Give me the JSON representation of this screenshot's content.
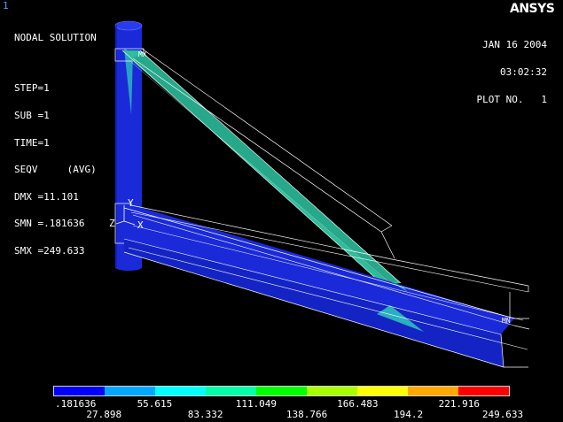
{
  "window_number": "1",
  "logo": "ANSYS",
  "info": {
    "title": "NODAL SOLUTION",
    "step": "STEP=1",
    "sub": "SUB =1",
    "time": "TIME=1",
    "seqv": "SEQV     (AVG)",
    "dmx": "DMX =11.101",
    "smn": "SMN =.181636",
    "smx": "SMX =249.633"
  },
  "datetime": {
    "date": "JAN 16 2004",
    "time": "03:02:32",
    "plot": "PLOT NO.   1"
  },
  "triad": {
    "y": "Y",
    "z": "Z",
    "x": "X"
  },
  "markers": {
    "mx": "MX",
    "mn": "MN"
  },
  "legend": {
    "colors": [
      "#0000ff",
      "#00a8ff",
      "#00ffff",
      "#00ffa8",
      "#00ff00",
      "#a8ff00",
      "#ffff00",
      "#ffa800",
      "#ff0000"
    ],
    "top_labels": [
      ".181636",
      "55.615",
      "111.049",
      "166.483",
      "221.916"
    ],
    "bottom_labels": [
      "27.898",
      "83.332",
      "138.766",
      "194.2",
      "249.633"
    ]
  },
  "colors": {
    "background": "#000000",
    "structure_blue": "#1a2ad8",
    "brace_teal": "#2cbf9c",
    "edge": "#ffffff"
  }
}
